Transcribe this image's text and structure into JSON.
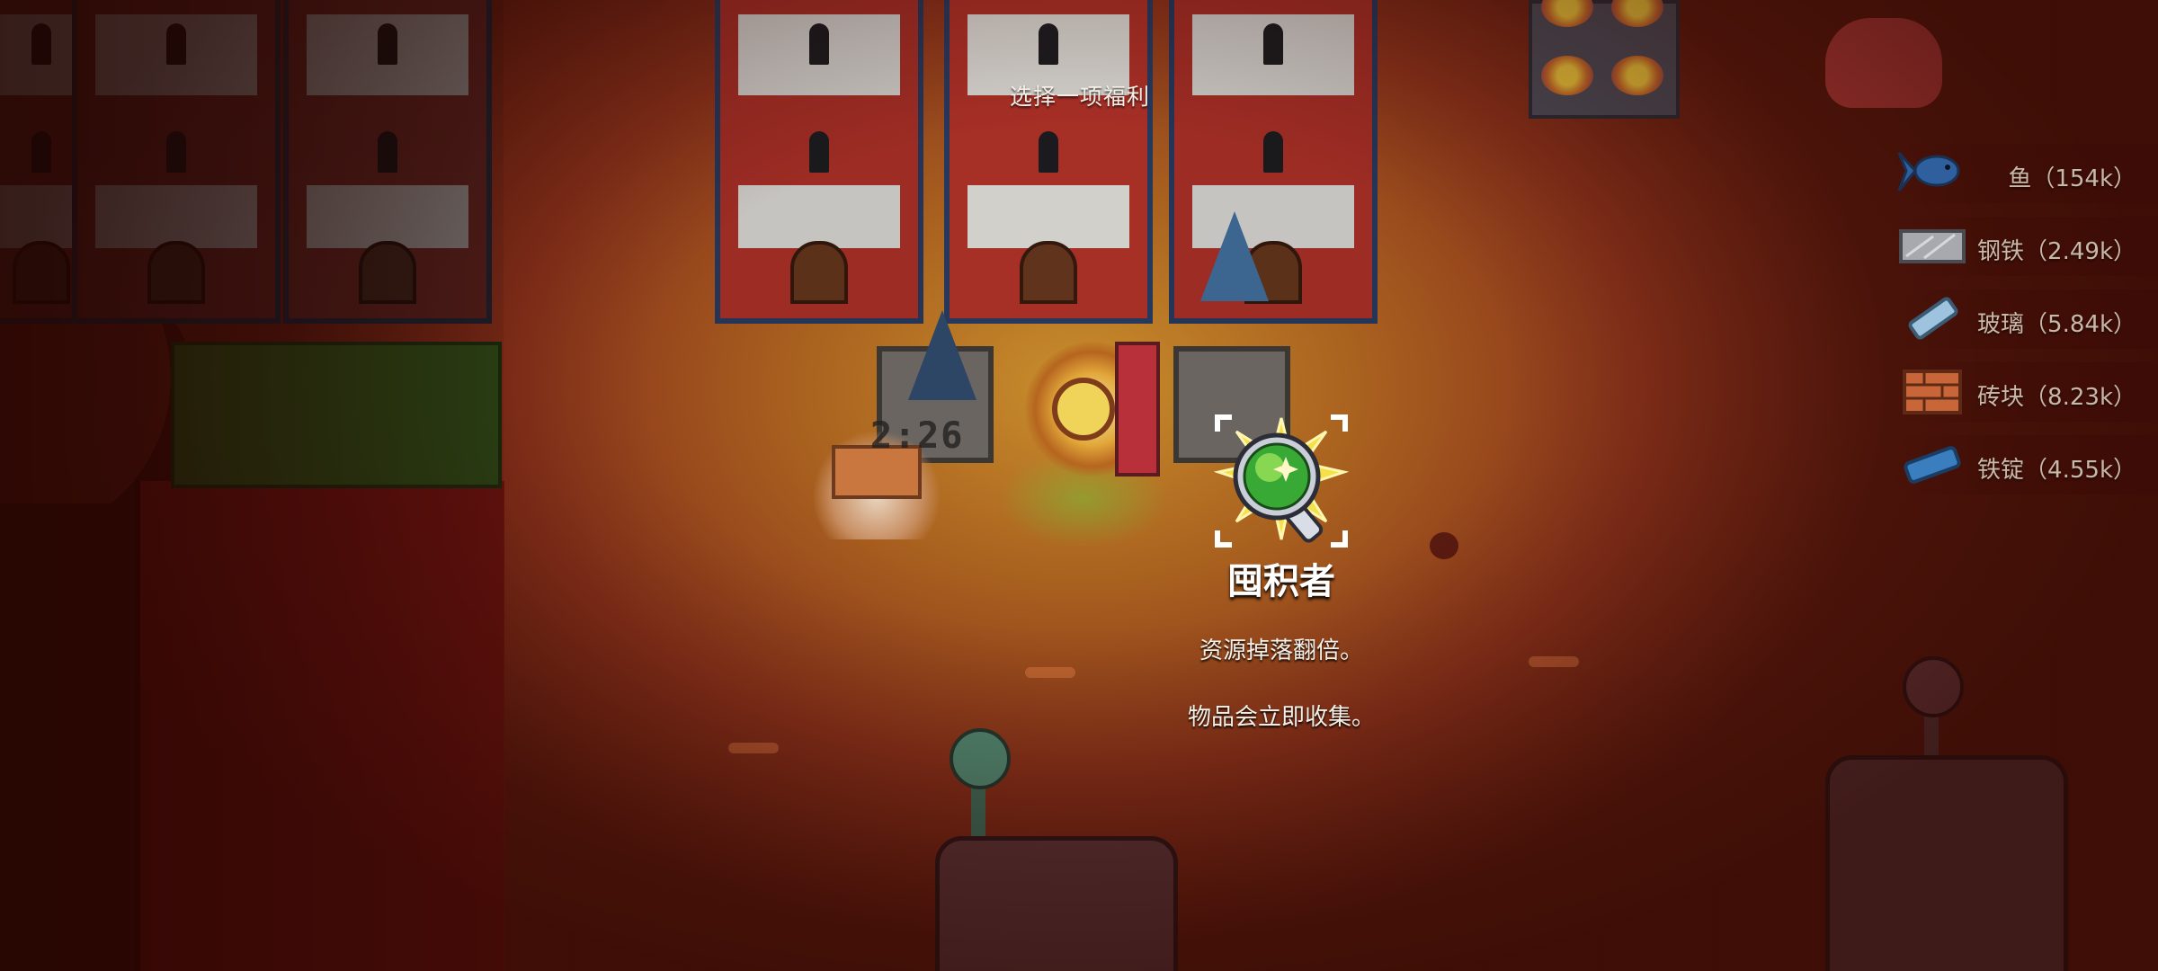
{
  "header": {
    "title": "选择一项福利"
  },
  "perk": {
    "icon": "magnifier-green-orb-icon",
    "name": "囤积者",
    "description_lines": [
      "资源掉落翻倍。",
      "物品会立即收集。"
    ]
  },
  "timer": {
    "text": "2:26"
  },
  "resources": [
    {
      "icon": "fish-icon",
      "text": "鱼（154k）"
    },
    {
      "icon": "steel-icon",
      "text": "钢铁（2.49k）"
    },
    {
      "icon": "glass-icon",
      "text": "玻璃（5.84k）"
    },
    {
      "icon": "brick-icon",
      "text": "砖块（8.23k）"
    },
    {
      "icon": "iron-ingot-icon",
      "text": "铁锭（4.55k）"
    }
  ]
}
